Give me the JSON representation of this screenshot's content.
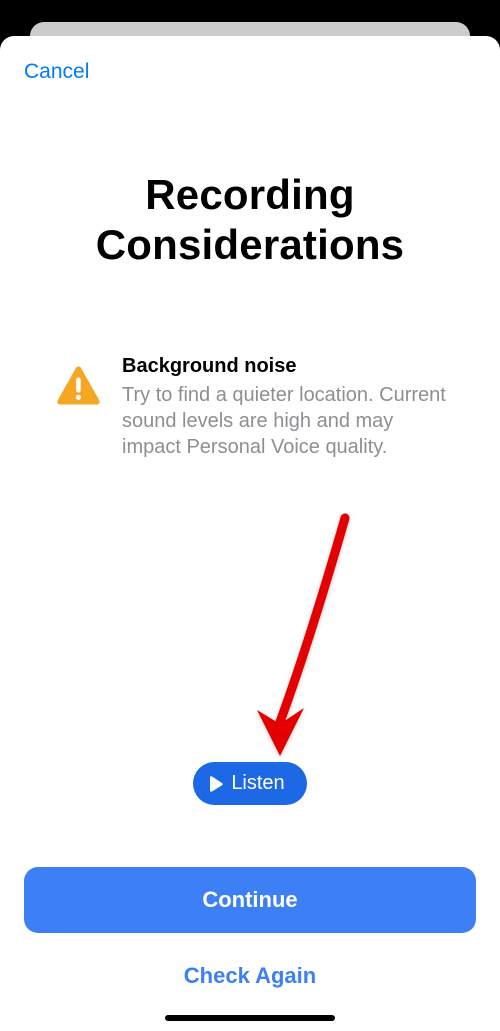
{
  "nav": {
    "cancel_label": "Cancel"
  },
  "title": "Recording Considerations",
  "consideration": {
    "icon_name": "warning-triangle-icon",
    "icon_color": "#F5A623",
    "heading": "Background noise",
    "body": "Try to find a quieter location. Current sound levels are high and may impact Personal Voice quality."
  },
  "listen": {
    "label": "Listen",
    "bg_color": "#1D68E5"
  },
  "actions": {
    "continue_label": "Continue",
    "check_again_label": "Check Again",
    "primary_color": "#3D7FF4"
  },
  "annotation": {
    "arrow_color": "#E30000"
  }
}
